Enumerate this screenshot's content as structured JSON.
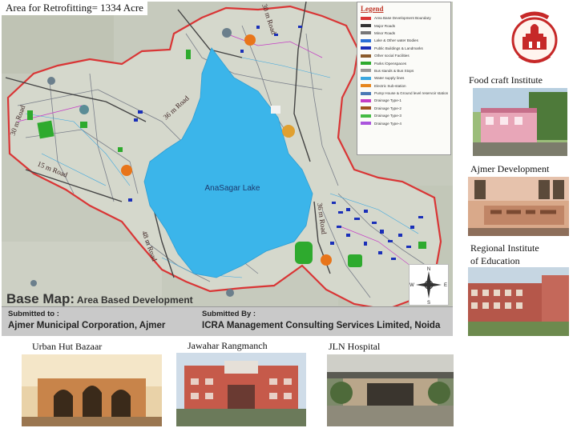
{
  "header": {
    "title": "Area for Retrofitting= 1334 Acre"
  },
  "map": {
    "lake_label": "AnaSagar Lake",
    "road_labels": [
      "30 m Road",
      "36 m Road",
      "15 m Road",
      "48 m Road",
      "36 m Road",
      "30 m Road"
    ],
    "legend": {
      "title": "Legend",
      "items": [
        {
          "label": "Area Base Development Boundary",
          "color": "#d93535"
        },
        {
          "label": "Major Roads",
          "color": "#333333"
        },
        {
          "label": "Minor Roads",
          "color": "#777777"
        },
        {
          "label": "Lake & Other water Bodies",
          "color": "#2a6fd6"
        },
        {
          "label": "Public Buildings & Landmarks",
          "color": "#1a2fb8"
        },
        {
          "label": "Other social Facilities",
          "color": "#8a5a2b"
        },
        {
          "label": "Parks /Openspaces",
          "color": "#2eaa2e"
        },
        {
          "label": "Bus stands & Bus Stops",
          "color": "#999999"
        },
        {
          "label": "Water supply lines",
          "color": "#3aa7e0"
        },
        {
          "label": "Electric Sub-station",
          "color": "#e6861f"
        },
        {
          "label": "Pump House & Ground level reservoir station",
          "color": "#4a78b5"
        },
        {
          "label": "Drainage Type-1",
          "color": "#c53cc5"
        },
        {
          "label": "Drainage Type-2",
          "color": "#a0521e"
        },
        {
          "label": "Drainage Type-3",
          "color": "#44bb44"
        },
        {
          "label": "Drainage Type-4",
          "color": "#aa55dd"
        }
      ]
    },
    "compass": {
      "n": "N",
      "s": "S",
      "e": "E",
      "w": "W"
    }
  },
  "basemap": {
    "title_big": "Base Map:",
    "title_rest": " Area Based Development"
  },
  "submission": {
    "to_label": "Submitted to :",
    "to_value": "Ajmer Municipal Corporation, Ajmer",
    "by_label": "Submitted By :",
    "by_value": "ICRA Management Consulting Services Limited, Noida"
  },
  "photos": {
    "food_craft": "Food craft Institute",
    "ajmer_dev": "Ajmer Development",
    "regional": "Regional Institute",
    "regional_2": "of Education",
    "urban_hut": "Urban Hut Bazaar",
    "jawahar": "Jawahar Rangmanch",
    "jln": "JLN Hospital"
  },
  "colors": {
    "lake": "#3bb5ea",
    "boundary": "#d93535",
    "ground": "#c9cdbf",
    "park": "#2eaa2e",
    "building": "#1a2fb8",
    "marker_orange": "#e8751a",
    "marker_grey": "#6b7f8c"
  }
}
